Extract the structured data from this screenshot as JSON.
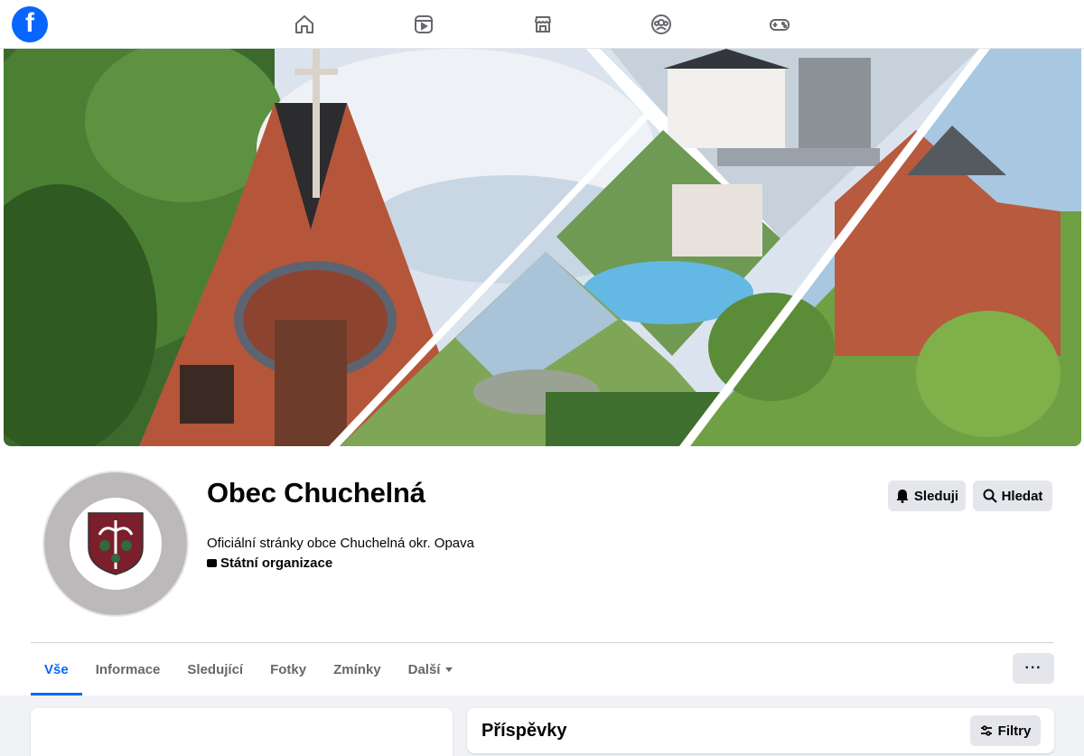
{
  "nav": {
    "logo_letter": "f",
    "icons": [
      "home-icon",
      "video-icon",
      "marketplace-icon",
      "groups-icon",
      "gaming-icon"
    ]
  },
  "page": {
    "name": "Obec Chuchelná",
    "description": "Oficiální stránky obce Chuchelná okr. Opava",
    "category": "Státní organizace"
  },
  "actions": {
    "follow_label": "Sleduji",
    "search_label": "Hledat"
  },
  "tabs": [
    {
      "label": "Vše",
      "active": true
    },
    {
      "label": "Informace"
    },
    {
      "label": "Sledující"
    },
    {
      "label": "Fotky"
    },
    {
      "label": "Zmínky"
    },
    {
      "label": "Další"
    }
  ],
  "more_label": "···",
  "posts": {
    "title": "Příspěvky",
    "filters_label": "Filtry"
  },
  "colors": {
    "brand": "#0866ff",
    "button_bg": "#e4e6eb",
    "page_bg": "#f0f2f5"
  }
}
